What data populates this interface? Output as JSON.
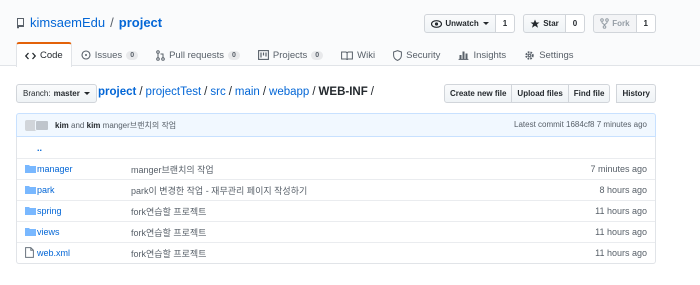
{
  "repo": {
    "owner": "kimsaemEdu",
    "separator": "/",
    "name": "project"
  },
  "actions": {
    "watch": {
      "label": "Unwatch",
      "count": "1"
    },
    "star": {
      "label": "Star",
      "count": "0"
    },
    "fork": {
      "label": "Fork",
      "count": "1"
    }
  },
  "tabs": [
    {
      "label": "Code"
    },
    {
      "label": "Issues",
      "count": "0"
    },
    {
      "label": "Pull requests",
      "count": "0"
    },
    {
      "label": "Projects",
      "count": "0"
    },
    {
      "label": "Wiki"
    },
    {
      "label": "Security"
    },
    {
      "label": "Insights"
    },
    {
      "label": "Settings"
    }
  ],
  "branch": {
    "label": "Branch:",
    "value": "master"
  },
  "breadcrumb": {
    "parts": [
      "project",
      "projectTest",
      "src",
      "main",
      "webapp"
    ],
    "separator": "/",
    "final": "WEB-INF",
    "trailing": "/"
  },
  "file_buttons": [
    "Create new file",
    "Upload files",
    "Find file",
    "History"
  ],
  "commit": {
    "author1": "kim",
    "and": "and",
    "author2": "kim",
    "message": "manger브랜치의 작업",
    "latest_label": "Latest commit",
    "sha": "1684cf8",
    "age": "7 minutes ago"
  },
  "files": {
    "up": "..",
    "rows": [
      {
        "name": "manager",
        "type": "dir",
        "message": "manger브랜치의 작업",
        "age": "7 minutes ago"
      },
      {
        "name": "park",
        "type": "dir",
        "message": "park이 변경한 작업 - 재무관리 페이지 작성하기",
        "age": "8 hours ago"
      },
      {
        "name": "spring",
        "type": "dir",
        "message": "fork연습할 프로젝트",
        "age": "11 hours ago"
      },
      {
        "name": "views",
        "type": "dir",
        "message": "fork연습할 프로젝트",
        "age": "11 hours ago"
      },
      {
        "name": "web.xml",
        "type": "file",
        "message": "fork연습할 프로젝트",
        "age": "11 hours ago"
      }
    ]
  },
  "colors": {
    "link": "#0366d6",
    "folder": "#79b8ff",
    "tab_accent": "#e36209",
    "commit_bg": "#f1f8ff"
  },
  "icons": [
    "repo-icon",
    "eye-icon",
    "star-icon",
    "fork-icon",
    "code-icon",
    "issue-icon",
    "pull-request-icon",
    "project-icon",
    "wiki-icon",
    "shield-icon",
    "graph-icon",
    "gear-icon",
    "folder-icon",
    "file-icon"
  ]
}
